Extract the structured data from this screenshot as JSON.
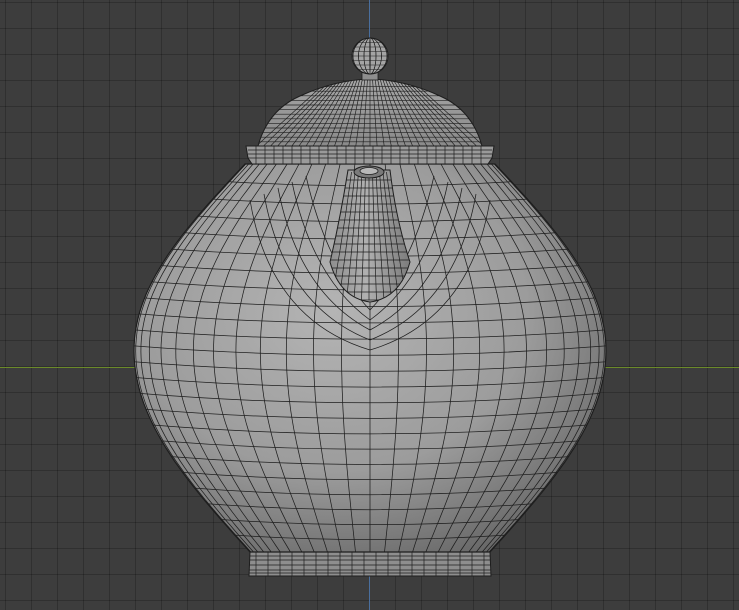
{
  "viewport": {
    "background_color": "#3d3d3d",
    "grid_line_color": "#2f2f2f",
    "axis_y_color": "#4a6f9e",
    "axis_x_color": "#6b8a2a"
  },
  "model": {
    "object": "teapot",
    "display_mode": "solid-with-wireframe",
    "surface_color": "#9a9a9a",
    "wire_color": "#1e1e1e"
  }
}
